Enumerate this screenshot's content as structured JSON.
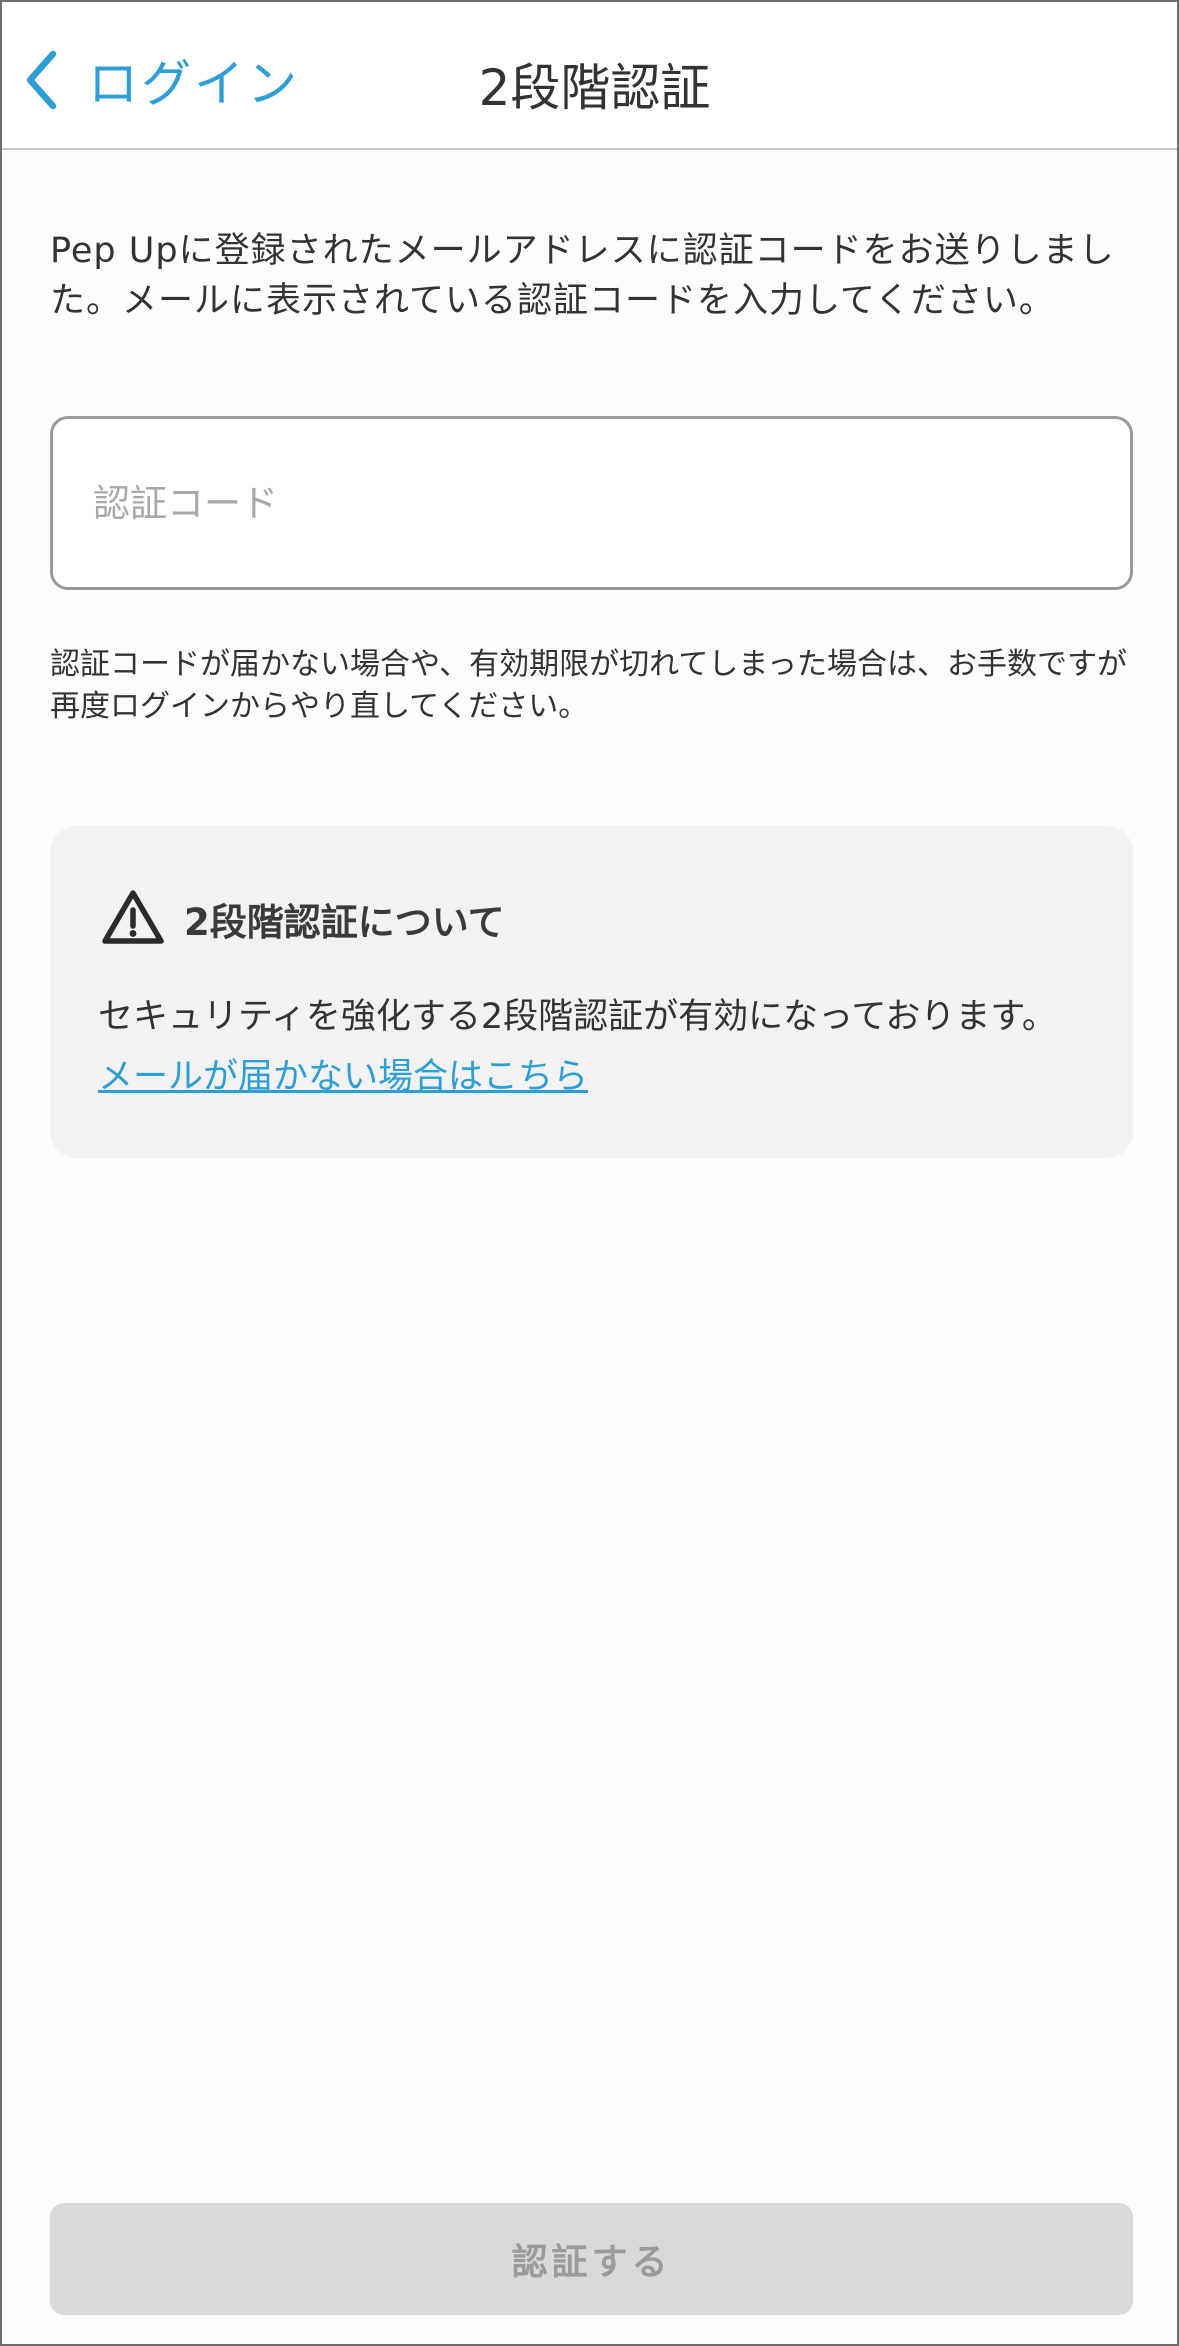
{
  "header": {
    "back_label": "ログイン",
    "back_icon": "chevron-left-icon",
    "title": "2段階認証"
  },
  "main": {
    "description": "Pep Upに登録されたメールアドレスに認証コードをお送りしました。メールに表示されている認証コードを入力してください。",
    "code_input": {
      "placeholder": "認証コード",
      "value": ""
    },
    "note": "認証コードが届かない場合や、有効期限が切れてしまった場合は、お手数ですが再度ログインからやり直してください。"
  },
  "info_card": {
    "icon": "warning-icon",
    "title": "2段階認証について",
    "body": "セキュリティを強化する2段階認証が有効になっております。",
    "link": "メールが届かない場合はこちら"
  },
  "footer": {
    "submit_label": "認証する"
  },
  "colors": {
    "accent": "#2e9fd6",
    "text": "#333333",
    "card_bg": "#f2f2f2",
    "button_disabled_bg": "#d9d9d9",
    "button_disabled_text": "#9a9a9a"
  }
}
